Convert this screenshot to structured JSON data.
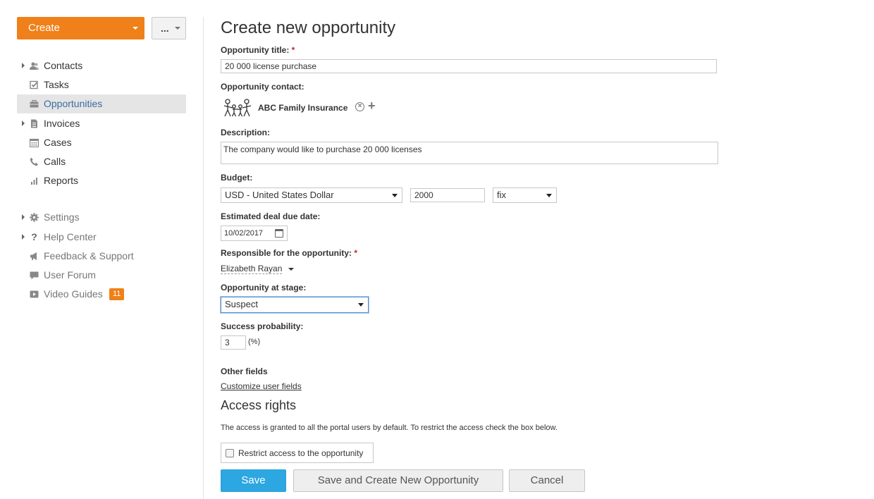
{
  "sidebar": {
    "create_label": "Create",
    "more_label": "...",
    "items": [
      {
        "label": "Contacts",
        "icon": "contacts-icon"
      },
      {
        "label": "Tasks",
        "icon": "tasks-icon"
      },
      {
        "label": "Opportunities",
        "icon": "opportunities-icon"
      },
      {
        "label": "Invoices",
        "icon": "invoices-icon"
      },
      {
        "label": "Cases",
        "icon": "cases-icon"
      },
      {
        "label": "Calls",
        "icon": "calls-icon"
      },
      {
        "label": "Reports",
        "icon": "reports-icon"
      }
    ],
    "bottom_items": [
      {
        "label": "Settings",
        "icon": "gear-icon"
      },
      {
        "label": "Help Center",
        "icon": "question-icon"
      },
      {
        "label": "Feedback & Support",
        "icon": "megaphone-icon"
      },
      {
        "label": "User Forum",
        "icon": "chat-icon"
      },
      {
        "label": "Video Guides",
        "icon": "play-icon",
        "badge": "11"
      }
    ],
    "active": "Opportunities"
  },
  "form": {
    "page_title": "Create new opportunity",
    "title_label": "Opportunity title:",
    "title_value": "20 000 license purchase",
    "contact_label": "Opportunity contact:",
    "contact_name": "ABC Family Insurance",
    "description_label": "Description:",
    "description_value": "The company would like to purchase 20 000 licenses",
    "budget_label": "Budget:",
    "currency": "USD - United States Dollar",
    "budget_amount": "2000",
    "budget_type": "fix",
    "due_date_label": "Estimated deal due date:",
    "due_date": "10/02/2017",
    "responsible_label": "Responsible for the opportunity:",
    "responsible_person": "Elizabeth Rayan",
    "stage_label": "Opportunity at stage:",
    "stage_value": "Suspect",
    "probability_label": "Success probability:",
    "probability_value": "3",
    "probability_unit": "(%)",
    "other_fields_label": "Other fields",
    "customize_link": "Customize user fields",
    "access_title": "Access rights",
    "access_note": "The access is granted to all the portal users by default. To restrict the access check the box below.",
    "restrict_label": "Restrict access to the opportunity",
    "required_mark": "*"
  },
  "buttons": {
    "save": "Save",
    "save_new": "Save and Create New Opportunity",
    "cancel": "Cancel"
  },
  "colors": {
    "accent_orange": "#f08019",
    "save_blue": "#2da7e1",
    "active_link": "#3c6ba1",
    "required_red": "#c3262c"
  }
}
